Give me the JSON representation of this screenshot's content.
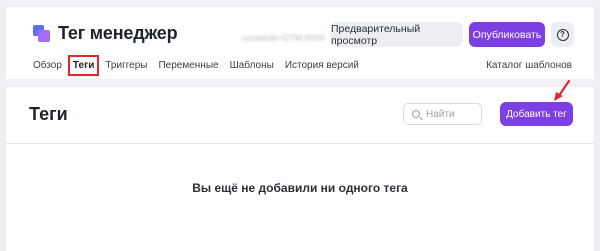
{
  "header": {
    "app_title": "Тег менеджер",
    "account_blur": "container-GTM-0000",
    "preview_label": "Предварительный просмотр",
    "publish_label": "Опубликовать",
    "help_glyph": "?"
  },
  "nav": {
    "items": [
      "Обзор",
      "Теги",
      "Триггеры",
      "Переменные",
      "Шаблоны",
      "История версий"
    ],
    "active": "Теги",
    "catalog_label": "Каталог шаблонов"
  },
  "main": {
    "title": "Теги",
    "search_placeholder": "Найти",
    "add_label": "Добавить тег",
    "empty_message": "Вы ещё не добавили ни одного тега"
  },
  "icons": {
    "logo": "logo-icon",
    "search": "search-icon",
    "help": "help-icon",
    "annotation": "arrow-icon"
  },
  "colors": {
    "accent": "#7b3fe4",
    "highlight": "#e0262f",
    "background": "#eef0f4"
  }
}
